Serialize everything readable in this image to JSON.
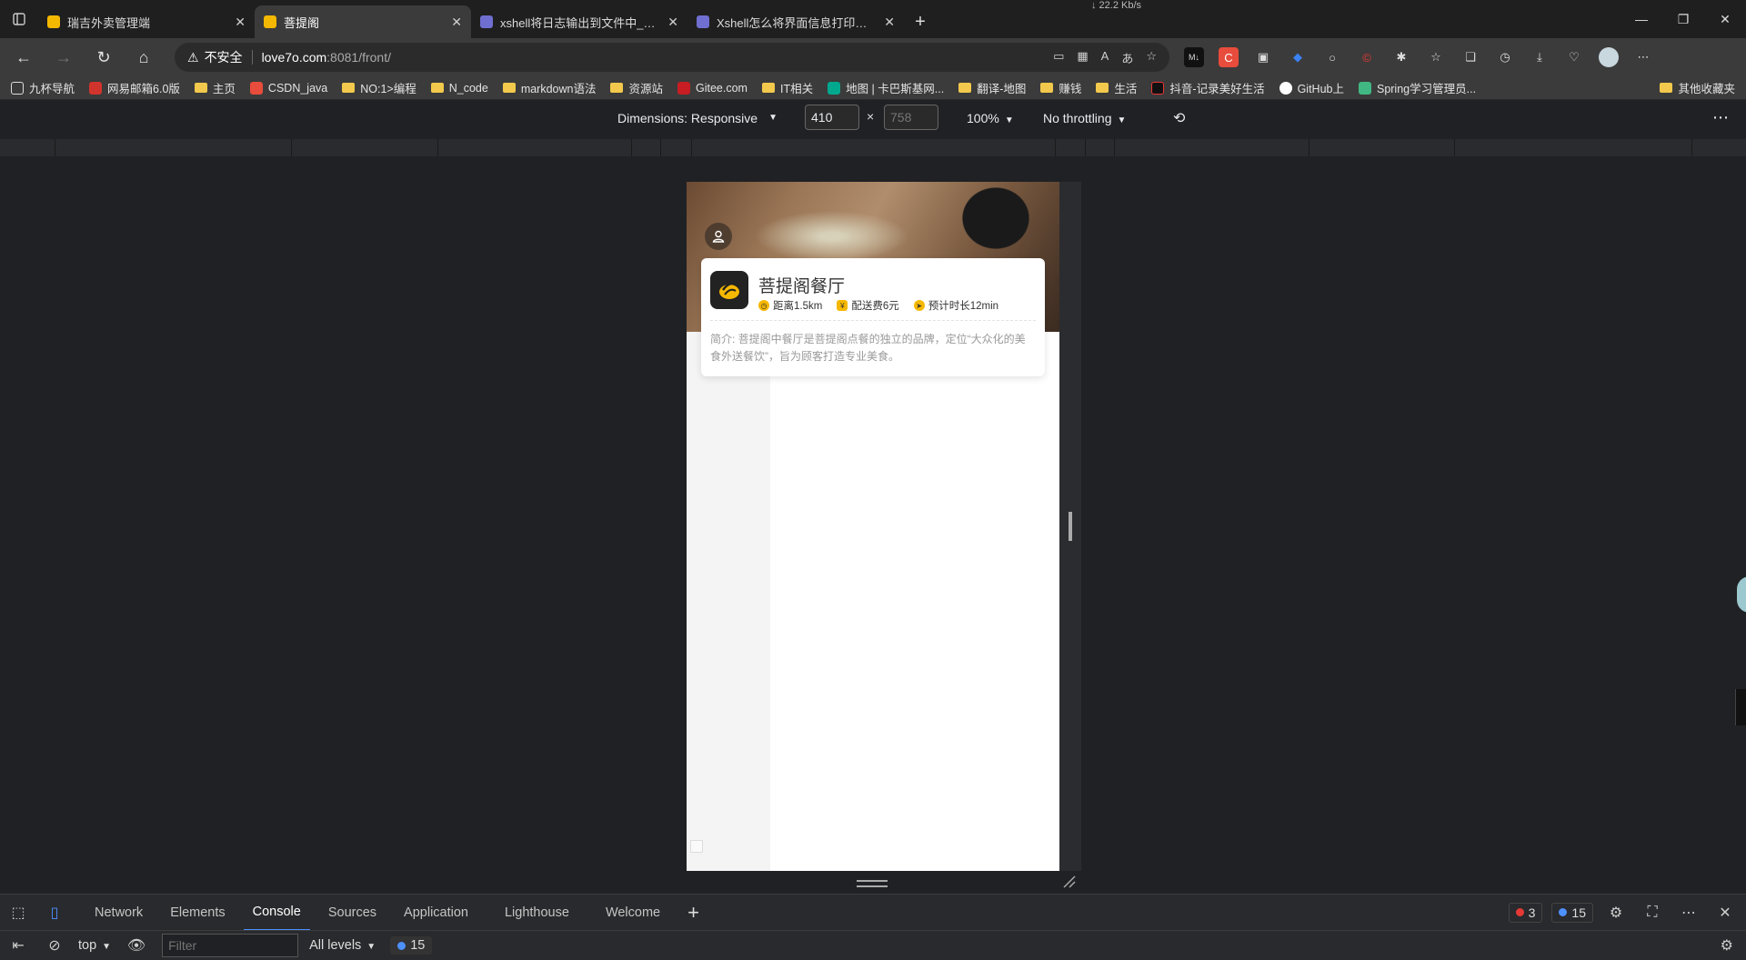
{
  "browser": {
    "net_speed": "↓ 22.2 Kb/s",
    "tabs": [
      {
        "title": "瑞吉外卖管理端",
        "active": false,
        "favicon_color": "#f5b800"
      },
      {
        "title": "菩提阁",
        "active": true,
        "favicon_color": "#f5b800"
      },
      {
        "title": "xshell将日志输出到文件中_百度",
        "active": false,
        "favicon_color": "#6f6fd1"
      },
      {
        "title": "Xshell怎么将界面信息打印到txt",
        "active": false,
        "favicon_color": "#6f6fd1"
      }
    ],
    "address": {
      "warning": "不安全",
      "host": "love7o.com",
      "path": ":8081/front/"
    },
    "bookmarks": [
      {
        "label": "九杯导航",
        "icon": "page"
      },
      {
        "label": "网易邮箱6.0版",
        "icon": "mail",
        "color": "#d0342c"
      },
      {
        "label": "主页",
        "icon": "folder"
      },
      {
        "label": "CSDN_java",
        "icon": "csdn",
        "color": "#e74c3c"
      },
      {
        "label": "NO:1>编程",
        "icon": "folder"
      },
      {
        "label": "N_code",
        "icon": "folder"
      },
      {
        "label": "markdown语法",
        "icon": "folder"
      },
      {
        "label": "资源站",
        "icon": "folder"
      },
      {
        "label": "Gitee.com",
        "icon": "gitee",
        "color": "#c71d23"
      },
      {
        "label": "IT相关",
        "icon": "folder"
      },
      {
        "label": "地图 | 卡巴斯基网...",
        "icon": "kaspersky",
        "color": "#00a88e"
      },
      {
        "label": "翻译-地图",
        "icon": "folder"
      },
      {
        "label": "赚钱",
        "icon": "folder"
      },
      {
        "label": "生活",
        "icon": "folder"
      },
      {
        "label": "抖音-记录美好生活",
        "icon": "douyin",
        "color": "#111111"
      },
      {
        "label": "GitHub上",
        "icon": "github",
        "color": "#ffffff"
      },
      {
        "label": "Spring学习管理员...",
        "icon": "vue",
        "color": "#41b883"
      }
    ],
    "bookmarks_other": "其他收藏夹"
  },
  "device_toolbar": {
    "dimensions_label": "Dimensions: Responsive",
    "width": "410",
    "height_placeholder": "758",
    "times": "×",
    "zoom": "100%",
    "throttling": "No throttling"
  },
  "app": {
    "shop_name": "菩提阁餐厅",
    "distance": "距离1.5km",
    "delivery_fee": "配送费6元",
    "eta": "预计时长12min",
    "intro": "简介: 菩提阁中餐厅是菩提阁点餐的独立的品牌，定位“大众化的美食外送餐饮”，旨为顾客打造专业美食。",
    "accent_color": "#f5b800"
  },
  "devtools": {
    "tabs": [
      "Network",
      "Elements",
      "Console",
      "Sources",
      "Application",
      "Lighthouse",
      "Welcome"
    ],
    "active_tab": "Console",
    "error_count": "3",
    "message_count": "15",
    "context": "top",
    "filter_placeholder": "Filter",
    "levels": "All levels",
    "console_messages": "15"
  }
}
